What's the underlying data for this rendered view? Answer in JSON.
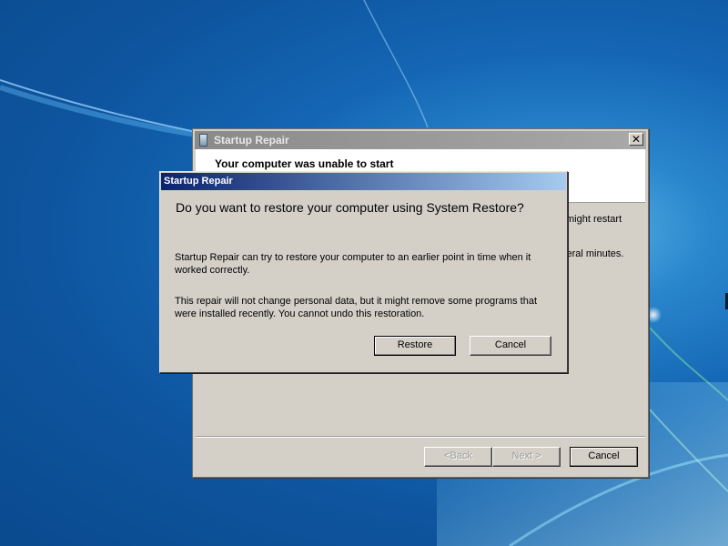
{
  "colors": {
    "desktop_blue": "#1466b4",
    "dialog_title_start": "#0a246a",
    "dialog_title_end": "#a6caf0",
    "window_face": "#d4d0c8"
  },
  "main_window": {
    "title": "Startup Repair",
    "title_icon": "startup-repair-icon",
    "close_glyph": "✕",
    "header_title": "Your computer was unable to start",
    "partial_text_1": "might restart",
    "partial_text_2": "veral minutes.",
    "buttons": {
      "back": "<Back",
      "next": "Next >",
      "cancel": "Cancel"
    }
  },
  "restore_dialog": {
    "title": "Startup Repair",
    "question": "Do you want to restore your computer using System Restore?",
    "paragraph_1": "Startup Repair can try to restore your computer to an earlier point in time when it worked correctly.",
    "paragraph_2": "This repair will not change personal data, but it might remove some programs that were installed recently. You cannot undo this restoration.",
    "buttons": {
      "restore": "Restore",
      "cancel": "Cancel"
    }
  }
}
